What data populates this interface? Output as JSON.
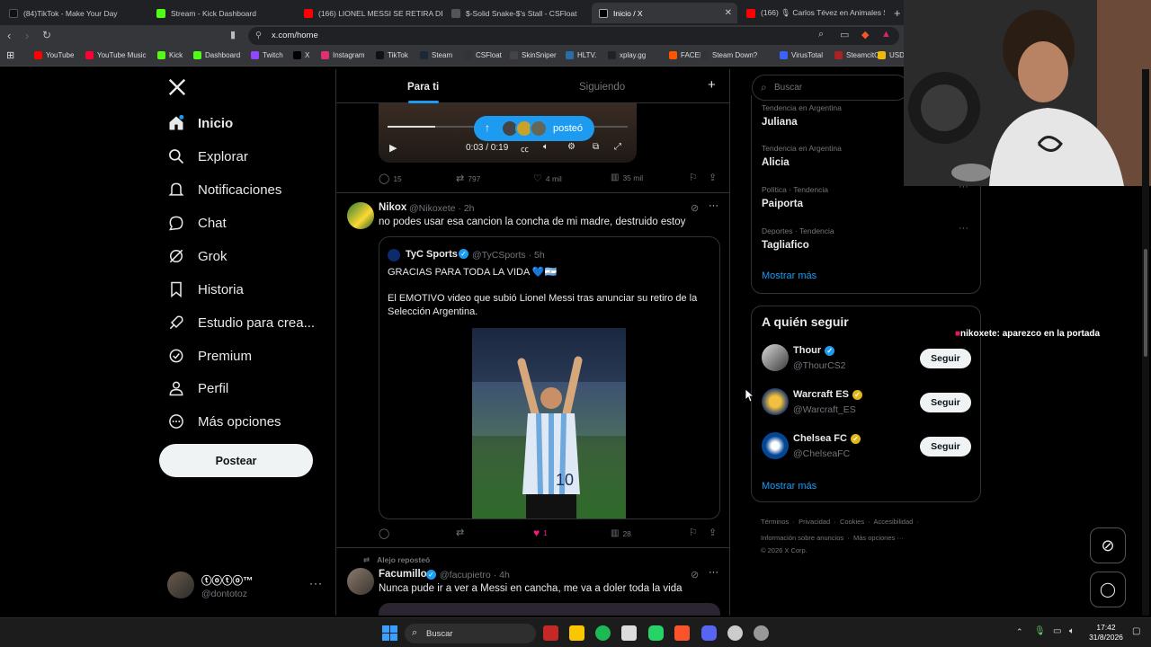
{
  "browser": {
    "tabs": [
      {
        "label": "(84)TikTok - Make Your Day",
        "color": "#111111"
      },
      {
        "label": "Stream - Kick Dashboard",
        "color": "#53fc18"
      },
      {
        "label": "(166) LIONEL MESSI SE RETIRA DE LA",
        "color": "#ff0000"
      },
      {
        "label": "$-Solid Snake-$'s Stall - CSFloat",
        "color": "#444444"
      },
      {
        "label": "Inicio / X",
        "color": "#000000"
      },
      {
        "label": "(166) 🎙 Carlos Tévez en Animales S",
        "color": "#ff0000"
      }
    ],
    "url": "x.com/home",
    "bookmarks": [
      {
        "label": "YouTube",
        "color": "#ff0000"
      },
      {
        "label": "YouTube Music",
        "color": "#ff0033"
      },
      {
        "label": "Kick",
        "color": "#53fc18"
      },
      {
        "label": "Dashboard",
        "color": "#53fc18"
      },
      {
        "label": "Twitch",
        "color": "#9146ff"
      },
      {
        "label": "X",
        "color": "#000000"
      },
      {
        "label": "Instagram",
        "color": "#e1306c"
      },
      {
        "label": "TikTok",
        "color": "#111111"
      },
      {
        "label": "Steam",
        "color": "#1b2838"
      },
      {
        "label": "CSFloat",
        "color": "#333333"
      },
      {
        "label": "SkinSniper",
        "color": "#444444"
      },
      {
        "label": "HLTV.",
        "color": "#2b6ea6"
      },
      {
        "label": "xplay.gg",
        "color": "#222222"
      },
      {
        "label": "FACEIT",
        "color": "#ff5500"
      },
      {
        "label": "Steam Down?",
        "color": "#333333"
      },
      {
        "label": "VirusTotal",
        "color": "#3b61ff"
      },
      {
        "label": "SteamcitO",
        "color": "#aa2222"
      },
      {
        "label": "USD",
        "color": "#f0b90b"
      }
    ]
  },
  "sidebar": {
    "items": [
      {
        "label": "Inicio",
        "icon": "home-icon"
      },
      {
        "label": "Explorar",
        "icon": "search-icon"
      },
      {
        "label": "Notificaciones",
        "icon": "bell-icon"
      },
      {
        "label": "Chat",
        "icon": "chat-icon"
      },
      {
        "label": "Grok",
        "icon": "grok-icon"
      },
      {
        "label": "Historia",
        "icon": "bookmark-icon"
      },
      {
        "label": "Estudio para crea...",
        "icon": "rocket-icon"
      },
      {
        "label": "Premium",
        "icon": "verified-icon"
      },
      {
        "label": "Perfil",
        "icon": "person-icon"
      },
      {
        "label": "Más opciones",
        "icon": "more-circle-icon"
      }
    ],
    "post_label": "Postear",
    "account_name": "ⓣⓞⓣⓞ™",
    "account_handle": "@dontotoz"
  },
  "feed": {
    "tabs": [
      "Para ti",
      "Siguiendo"
    ],
    "new_posts_pill": "posteó",
    "video": {
      "time": "0:03 / 0:19"
    },
    "post1_stats": {
      "replies": "15",
      "reposts": "797",
      "likes": "4 mil",
      "views": "35 mil"
    },
    "post2": {
      "name": "Nikox",
      "handle": "@Nikoxete · 2h",
      "text": "no podes usar esa cancion la concha de mi madre, destruido estoy",
      "quote": {
        "name": "TyC Sports",
        "handle": "@TyCSports · 5h",
        "line1": "GRACIAS PARA TODA LA VIDA 💙🇦🇷",
        "line2": "El EMOTIVO video que subió Lionel Messi tras anunciar su retiro de la Selección Argentina."
      },
      "stats": {
        "likes": "1",
        "views": "28"
      }
    },
    "post3": {
      "reposted_by": "Alejo reposteó",
      "name": "Facumillo",
      "handle": "@facupietro · 4h",
      "text": "Nunca pude ir a ver a Messi en cancha, me va a doler toda la vida"
    }
  },
  "right": {
    "search_placeholder": "Buscar",
    "trends": [
      {
        "context": "Tendencia en Argentina",
        "name": "Juliana"
      },
      {
        "context": "Tendencia en Argentina",
        "name": "Alicia"
      },
      {
        "context": "Política · Tendencia",
        "name": "Paiporta"
      },
      {
        "context": "Deportes · Tendencia",
        "name": "Tagliafico"
      }
    ],
    "show_more": "Mostrar más",
    "who_to_follow_title": "A quién seguir",
    "follow_label": "Seguir",
    "suggestions": [
      {
        "name": "Thour",
        "handle": "@ThourCS2"
      },
      {
        "name": "Warcraft ES",
        "handle": "@Warcraft_ES"
      },
      {
        "name": "Chelsea FC",
        "handle": "@ChelseaFC"
      }
    ],
    "footer": [
      "Términos",
      "Privacidad",
      "Cookies",
      "Accesibilidad",
      "Información sobre anuncios",
      "Más opciones ···",
      "© 2026 X Corp."
    ]
  },
  "overlay": {
    "chat_message": "nikoxete:  aparezco en la portada"
  },
  "taskbar": {
    "search_label": "Buscar",
    "time": "17:42",
    "date": "31/8/2026"
  },
  "colors": {
    "accent": "#1d9bf0",
    "like": "#f91880",
    "verified_gold": "#e2b719"
  }
}
